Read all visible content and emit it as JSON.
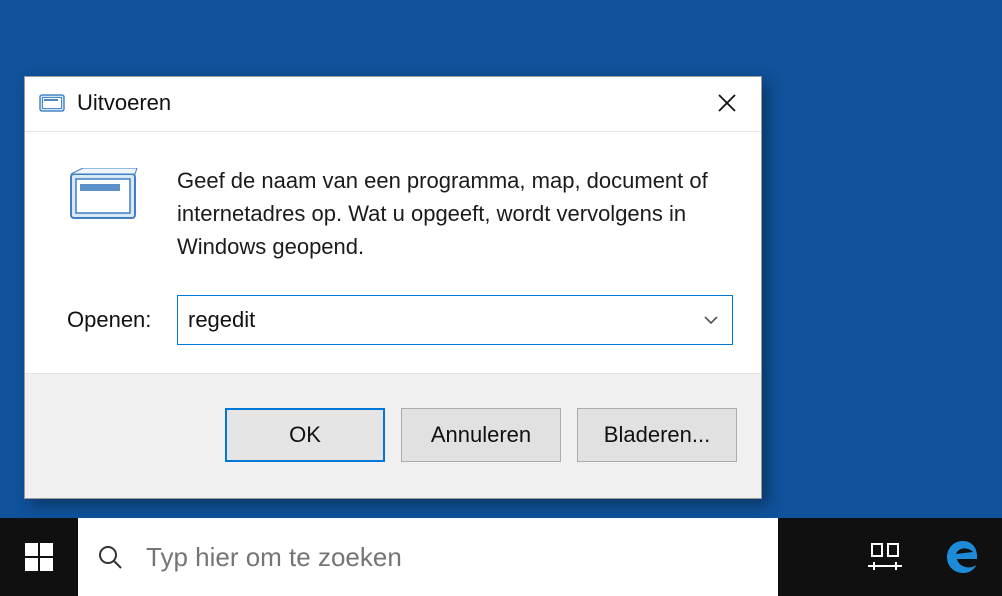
{
  "dialog": {
    "title": "Uitvoeren",
    "description": "Geef de naam van een programma, map, document of internetadres op. Wat u opgeeft, wordt vervolgens in Windows geopend.",
    "open_label": "Openen:",
    "input_value": "regedit",
    "buttons": {
      "ok": "OK",
      "cancel": "Annuleren",
      "browse": "Bladeren..."
    }
  },
  "taskbar": {
    "search_placeholder": "Typ hier om te zoeken"
  }
}
